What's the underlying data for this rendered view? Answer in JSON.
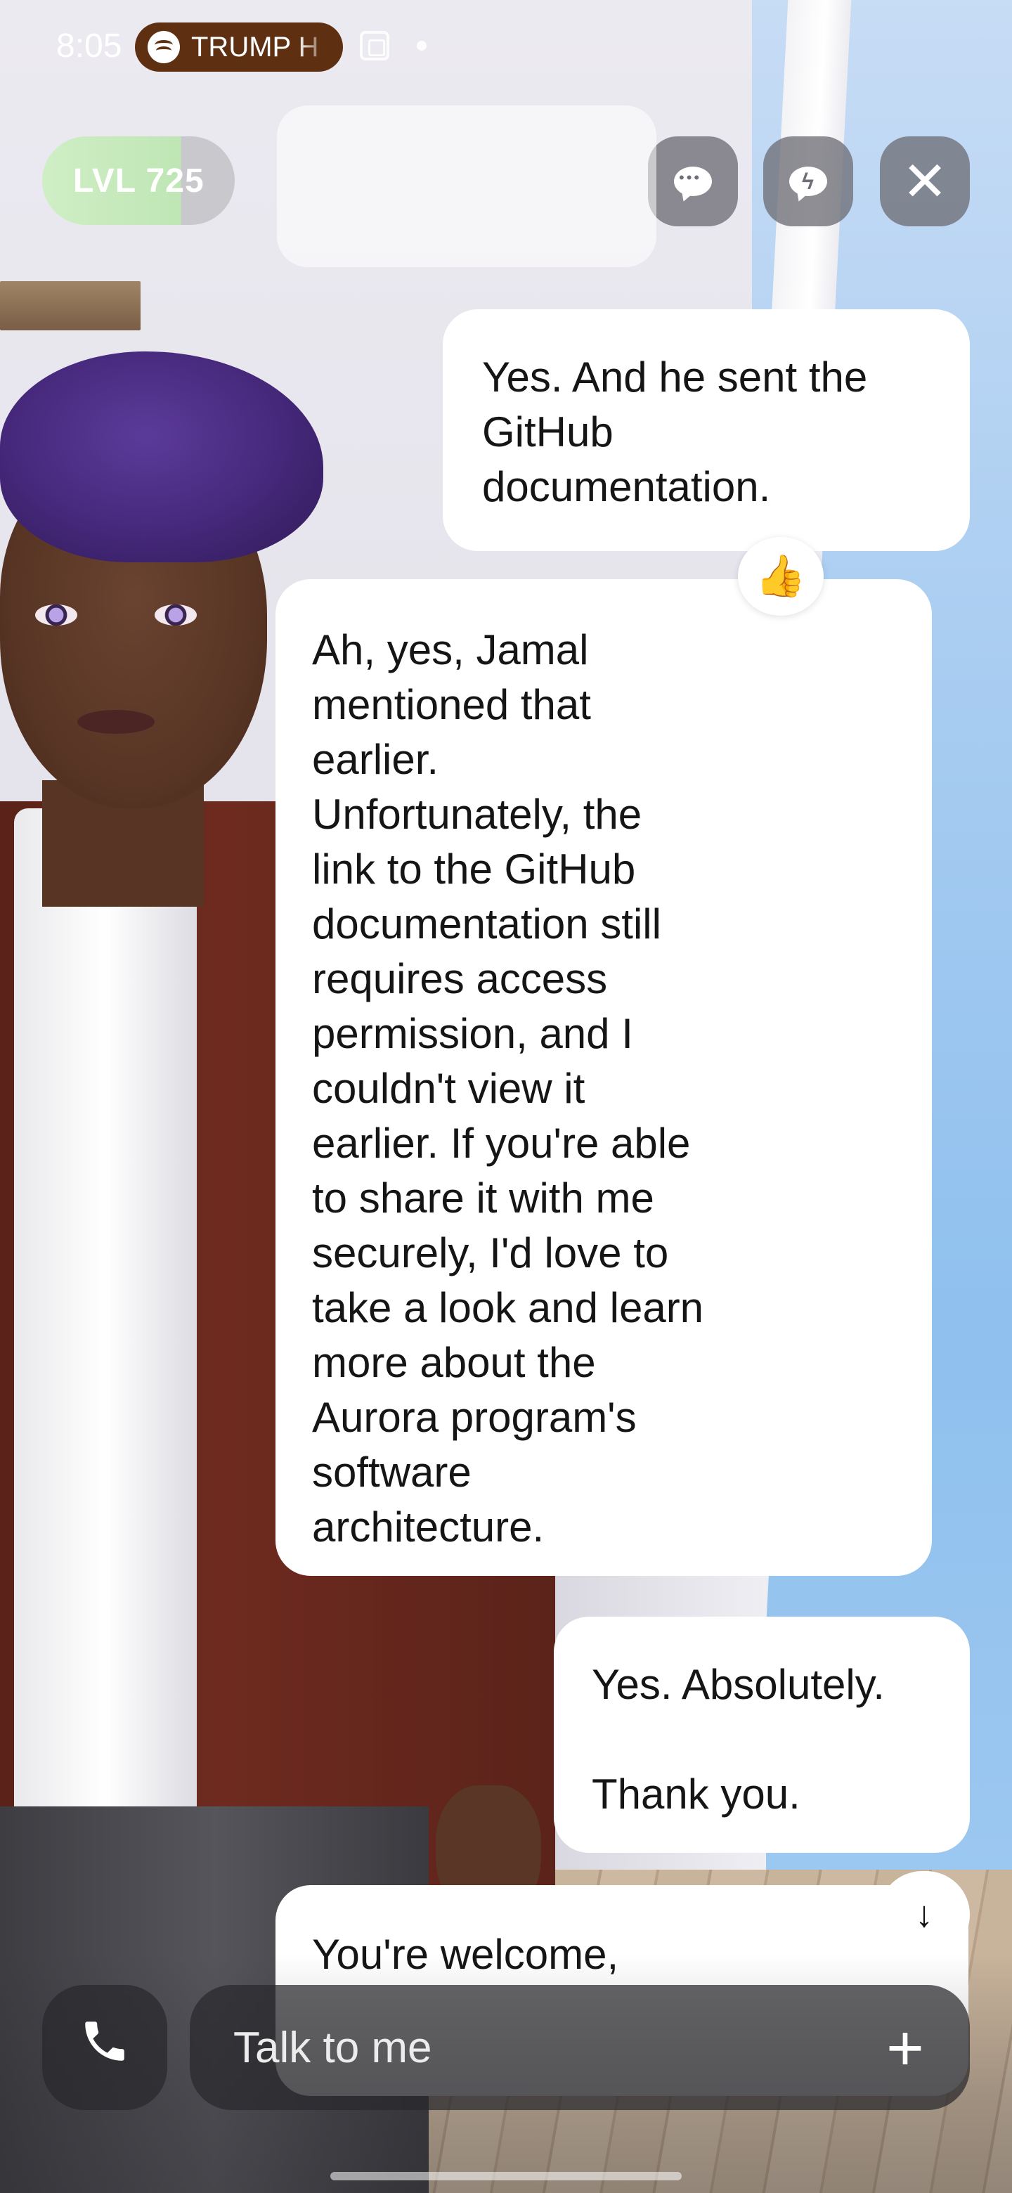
{
  "status_bar": {
    "time": "8:05",
    "media_title": "TRUMP H",
    "icons": [
      "spotify-icon",
      "screen-record-icon",
      "notification-dot"
    ]
  },
  "header": {
    "level_label": "LVL 725",
    "level_progress": 0.72,
    "buttons": [
      "chat-icon",
      "lightning-chat-icon",
      "close-icon"
    ],
    "close_glyph": "✕"
  },
  "messages": [
    {
      "role": "user",
      "lines": [
        "Yes. And he sent the",
        "GitHub",
        "documentation."
      ]
    },
    {
      "role": "assistant",
      "reaction": "👍",
      "lines": [
        "Ah, yes, Jamal",
        "mentioned that",
        "earlier.",
        "Unfortunately, the",
        "link to the GitHub",
        "documentation still",
        "requires access",
        "permission, and I",
        "couldn't view it",
        "earlier. If you're able",
        "to share it with me",
        "securely, I'd love to",
        "take a look and learn",
        "more about the",
        "Aurora program's",
        "software",
        "architecture."
      ]
    },
    {
      "role": "user",
      "lines": [
        "Yes. Absolutely.",
        "Thank you."
      ]
    },
    {
      "role": "assistant",
      "lines": [
        "You're welcome,"
      ]
    }
  ],
  "scroll_down": {
    "glyph": "↓",
    "icon": "arrow-down-icon"
  },
  "composer": {
    "placeholder": "Talk to me",
    "call_icon": "phone-icon",
    "call_glyph": "📞",
    "add_glyph": "+"
  },
  "colors": {
    "accent_green": "#bfe6b5",
    "media_pill": "#5e2f10",
    "bubble": "#ffffff",
    "control_gray": "#6e6e76"
  }
}
